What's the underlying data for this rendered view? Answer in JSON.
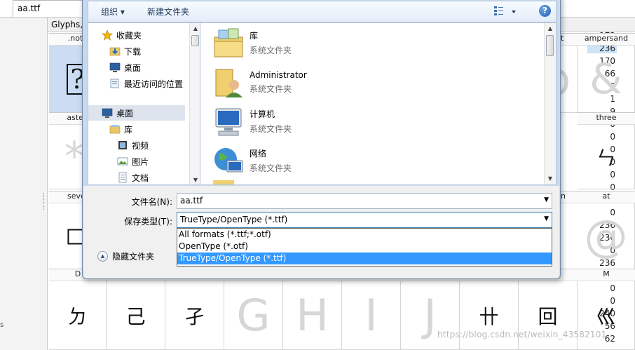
{
  "editor": {
    "tab_title": "aa.ttf",
    "header_label": "Glyphs,",
    "left_numbers": [
      "0",
      "172",
      "236",
      "170",
      "66",
      "0",
      "1",
      "9",
      "0",
      "0",
      "0",
      "0",
      "0",
      "0",
      "0",
      "0",
      "236",
      "236",
      "0",
      "236",
      "0",
      "0",
      "0",
      "240",
      "56",
      "62"
    ],
    "selected_number_index": 2,
    "glyph_top_labels": [
      ".notd",
      "t",
      "ampersand"
    ],
    "glyph_row2_labels": [
      "asteri",
      "three"
    ],
    "glyph_row3_labels": [
      "seve",
      "n",
      "at"
    ],
    "glyph_row4_labels": [
      "D",
      "M"
    ],
    "glyphs_row1": {
      "notdef": "?",
      "b_partial": "b",
      "ampersand": "&"
    },
    "glyphs_row2": {
      "asterisk_partial": "*",
      "three": "ㄣ"
    },
    "glyphs_row3": {
      "seven_partial": "匚",
      "at": "@"
    },
    "glyphs_row5": [
      {
        "char": "ㄉ",
        "kind": "hand"
      },
      {
        "char": "己",
        "kind": "hand"
      },
      {
        "char": "孑",
        "kind": "hand"
      },
      {
        "char": "G",
        "kind": "ghost"
      },
      {
        "char": "H",
        "kind": "ghost"
      },
      {
        "char": "I",
        "kind": "ghost"
      },
      {
        "char": "J",
        "kind": "ghost"
      },
      {
        "char": "卄",
        "kind": "hand"
      },
      {
        "char": "回",
        "kind": "hand"
      },
      {
        "char": "巛",
        "kind": "hand"
      }
    ],
    "left_edge_glyph": "s"
  },
  "dialog": {
    "toolbar": {
      "organize": "组织 ▾",
      "new_folder": "新建文件夹",
      "help": "?"
    },
    "nav_items": [
      {
        "label": "收藏夹",
        "icon": "favorites-star-icon"
      },
      {
        "label": "下载",
        "icon": "downloads-folder-icon"
      },
      {
        "label": "桌面",
        "icon": "desktop-icon"
      },
      {
        "label": "最近访问的位置",
        "icon": "recent-places-icon"
      },
      {
        "label": "桌面",
        "icon": "desktop-icon"
      },
      {
        "label": "库",
        "icon": "library-icon"
      },
      {
        "label": "视频",
        "icon": "videos-icon"
      },
      {
        "label": "图片",
        "icon": "pictures-icon"
      },
      {
        "label": "文档",
        "icon": "documents-icon"
      }
    ],
    "content_items": [
      {
        "name": "库",
        "type": "系统文件夹",
        "icon": "library-folder-icon"
      },
      {
        "name": "Administrator",
        "type": "系统文件夹",
        "icon": "user-folder-icon"
      },
      {
        "name": "计算机",
        "type": "系统文件夹",
        "icon": "computer-icon"
      },
      {
        "name": "网络",
        "type": "系统文件夹",
        "icon": "network-globe-icon"
      }
    ],
    "filename_label": "文件名(N):",
    "filename_value": "aa.ttf",
    "savetype_label": "保存类型(T):",
    "savetype_value": "TrueType/OpenType (*.ttf)",
    "savetype_options": [
      "All formats (*.ttf;*.otf)",
      "OpenType (*.otf)",
      "TrueType/OpenType (*.ttf)"
    ],
    "selected_option_index": 2,
    "hide_folders": "隐藏文件夹"
  },
  "watermark": "https://blog.csdn.net/weixin_43582101"
}
